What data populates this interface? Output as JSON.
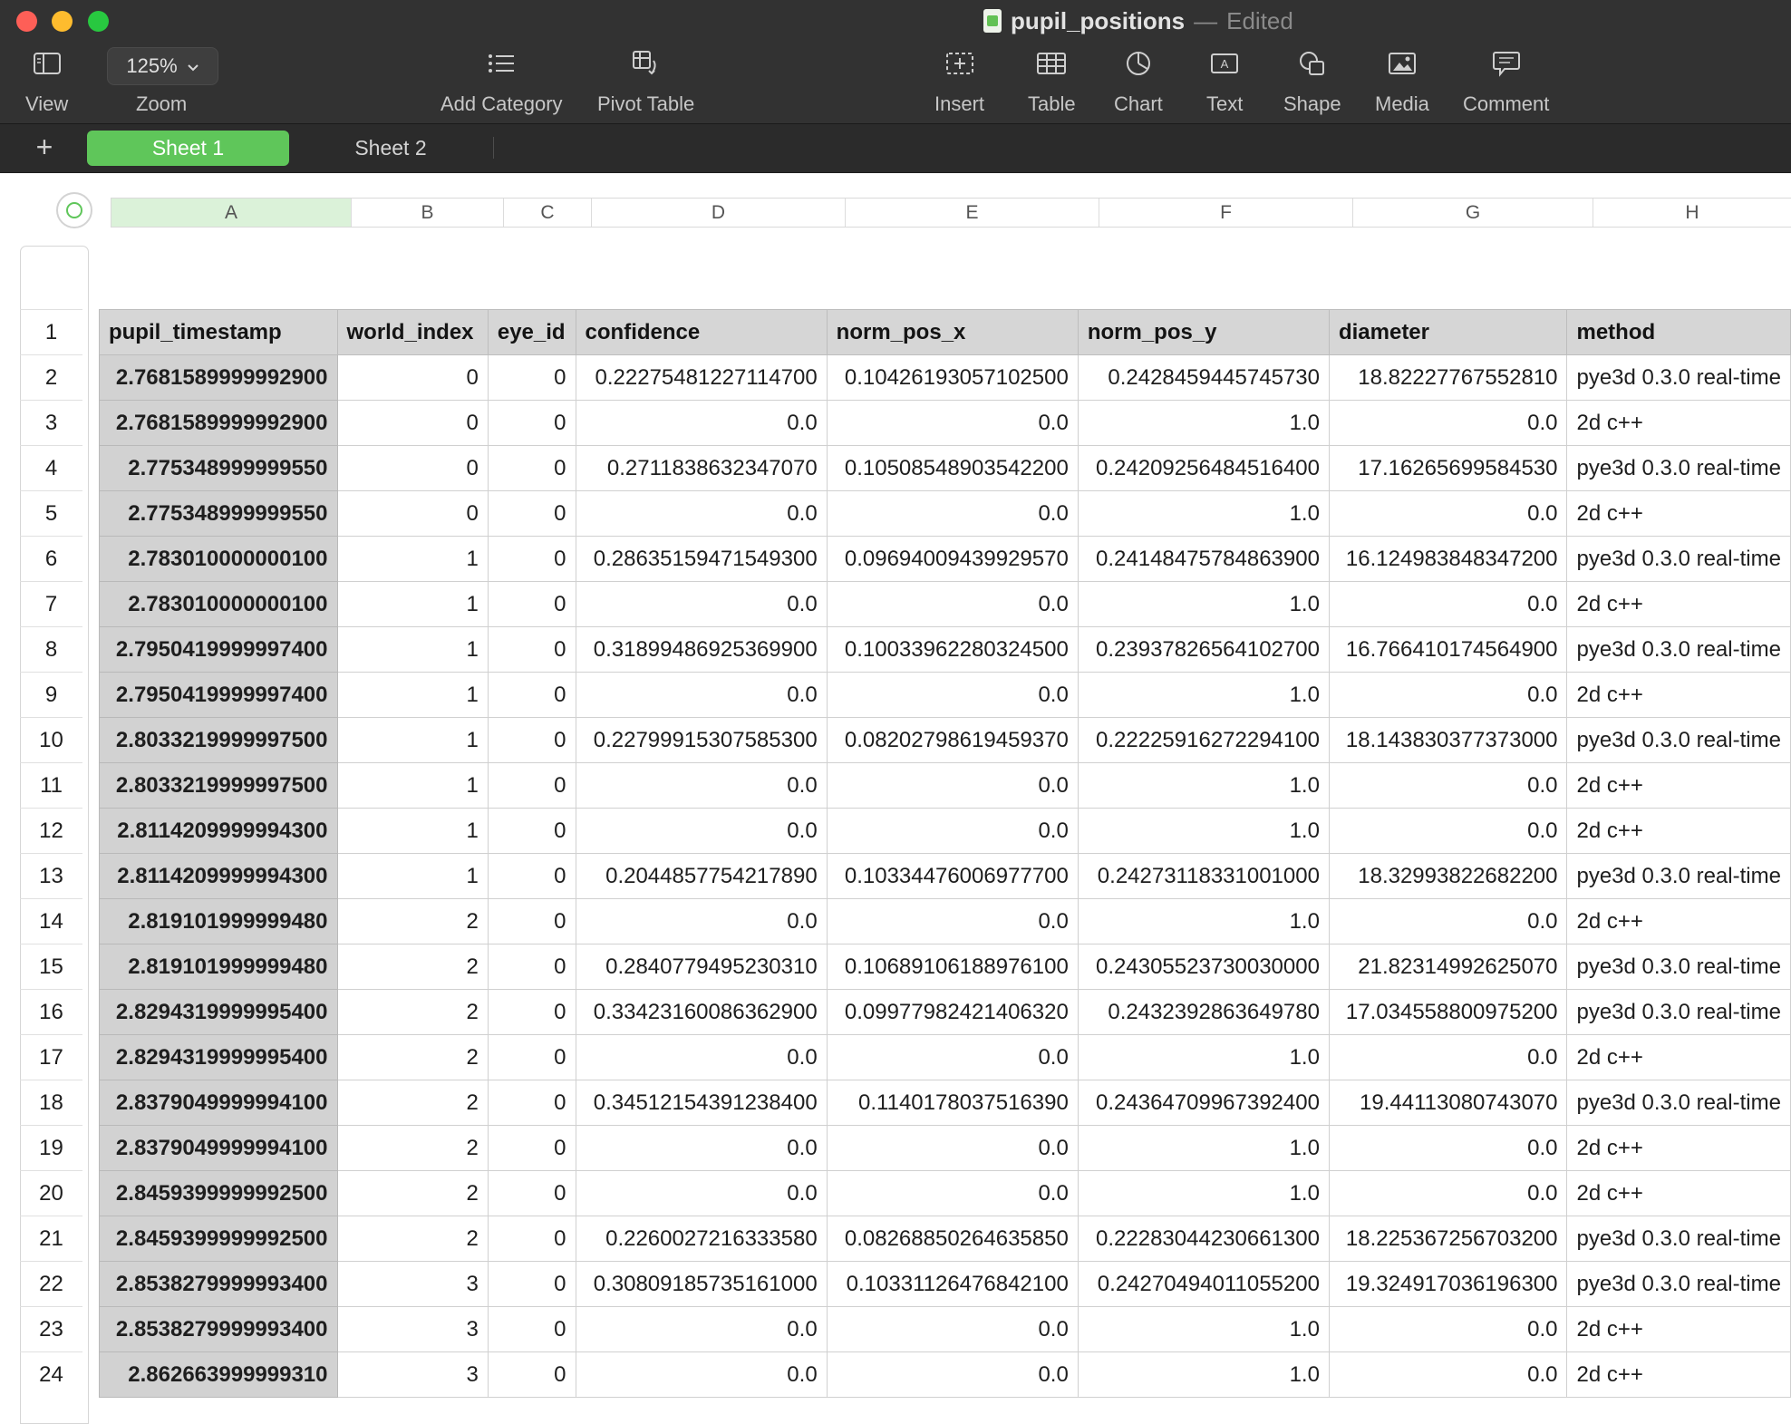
{
  "window": {
    "title": "pupil_positions",
    "separator": "—",
    "status": "Edited"
  },
  "toolbar": {
    "zoom_value": "125%",
    "items": {
      "view": "View",
      "zoom": "Zoom",
      "add_category": "Add Category",
      "pivot_table": "Pivot Table",
      "insert": "Insert",
      "table": "Table",
      "chart": "Chart",
      "text": "Text",
      "shape": "Shape",
      "media": "Media",
      "comment": "Comment"
    }
  },
  "tabs": {
    "add": "+",
    "sheet1": "Sheet 1",
    "sheet2": "Sheet 2"
  },
  "grid": {
    "columns": [
      "A",
      "B",
      "C",
      "D",
      "E",
      "F",
      "G",
      "H"
    ],
    "headers": [
      "pupil_timestamp",
      "world_index",
      "eye_id",
      "confidence",
      "norm_pos_x",
      "norm_pos_y",
      "diameter",
      "method"
    ],
    "rows": [
      [
        "2",
        "2.7681589999992900",
        "0",
        "0",
        "0.22275481227114700",
        "0.10426193057102500",
        "0.2428459445745730",
        "18.82227767552810",
        "pye3d 0.3.0 real-time"
      ],
      [
        "3",
        "2.7681589999992900",
        "0",
        "0",
        "0.0",
        "0.0",
        "1.0",
        "0.0",
        "2d c++"
      ],
      [
        "4",
        "2.775348999999550",
        "0",
        "0",
        "0.2711838632347070",
        "0.10508548903542200",
        "0.24209256484516400",
        "17.16265699584530",
        "pye3d 0.3.0 real-time"
      ],
      [
        "5",
        "2.775348999999550",
        "0",
        "0",
        "0.0",
        "0.0",
        "1.0",
        "0.0",
        "2d c++"
      ],
      [
        "6",
        "2.783010000000100",
        "1",
        "0",
        "0.28635159471549300",
        "0.09694009439929570",
        "0.24148475784863900",
        "16.124983848347200",
        "pye3d 0.3.0 real-time"
      ],
      [
        "7",
        "2.783010000000100",
        "1",
        "0",
        "0.0",
        "0.0",
        "1.0",
        "0.0",
        "2d c++"
      ],
      [
        "8",
        "2.7950419999997400",
        "1",
        "0",
        "0.31899486925369900",
        "0.10033962280324500",
        "0.23937826564102700",
        "16.766410174564900",
        "pye3d 0.3.0 real-time"
      ],
      [
        "9",
        "2.7950419999997400",
        "1",
        "0",
        "0.0",
        "0.0",
        "1.0",
        "0.0",
        "2d c++"
      ],
      [
        "10",
        "2.8033219999997500",
        "1",
        "0",
        "0.22799915307585300",
        "0.08202798619459370",
        "0.22225916272294100",
        "18.143830377373000",
        "pye3d 0.3.0 real-time"
      ],
      [
        "11",
        "2.8033219999997500",
        "1",
        "0",
        "0.0",
        "0.0",
        "1.0",
        "0.0",
        "2d c++"
      ],
      [
        "12",
        "2.8114209999994300",
        "1",
        "0",
        "0.0",
        "0.0",
        "1.0",
        "0.0",
        "2d c++"
      ],
      [
        "13",
        "2.8114209999994300",
        "1",
        "0",
        "0.2044857754217890",
        "0.10334476006977700",
        "0.24273118331001000",
        "18.32993822682200",
        "pye3d 0.3.0 real-time"
      ],
      [
        "14",
        "2.819101999999480",
        "2",
        "0",
        "0.0",
        "0.0",
        "1.0",
        "0.0",
        "2d c++"
      ],
      [
        "15",
        "2.819101999999480",
        "2",
        "0",
        "0.2840779495230310",
        "0.10689106188976100",
        "0.24305523730030000",
        "21.82314992625070",
        "pye3d 0.3.0 real-time"
      ],
      [
        "16",
        "2.8294319999995400",
        "2",
        "0",
        "0.33423160086362900",
        "0.09977982421406320",
        "0.2432392863649780",
        "17.034558800975200",
        "pye3d 0.3.0 real-time"
      ],
      [
        "17",
        "2.8294319999995400",
        "2",
        "0",
        "0.0",
        "0.0",
        "1.0",
        "0.0",
        "2d c++"
      ],
      [
        "18",
        "2.8379049999994100",
        "2",
        "0",
        "0.34512154391238400",
        "0.1140178037516390",
        "0.24364709967392400",
        "19.44113080743070",
        "pye3d 0.3.0 real-time"
      ],
      [
        "19",
        "2.8379049999994100",
        "2",
        "0",
        "0.0",
        "0.0",
        "1.0",
        "0.0",
        "2d c++"
      ],
      [
        "20",
        "2.8459399999992500",
        "2",
        "0",
        "0.0",
        "0.0",
        "1.0",
        "0.0",
        "2d c++"
      ],
      [
        "21",
        "2.8459399999992500",
        "2",
        "0",
        "0.2260027216333580",
        "0.08268850264635850",
        "0.22283044230661300",
        "18.225367256703200",
        "pye3d 0.3.0 real-time"
      ],
      [
        "22",
        "2.8538279999993400",
        "3",
        "0",
        "0.30809185735161000",
        "0.10331126476842100",
        "0.24270494011055200",
        "19.324917036196300",
        "pye3d 0.3.0 real-time"
      ],
      [
        "23",
        "2.8538279999993400",
        "3",
        "0",
        "0.0",
        "0.0",
        "1.0",
        "0.0",
        "2d c++"
      ],
      [
        "24",
        "2.862663999999310",
        "3",
        "0",
        "0.0",
        "0.0",
        "1.0",
        "0.0",
        "2d c++"
      ]
    ]
  },
  "colors": {
    "accent_green": "#5fc65a",
    "toolbar_bg": "#323232",
    "header_fill": "#d6d6d6"
  }
}
